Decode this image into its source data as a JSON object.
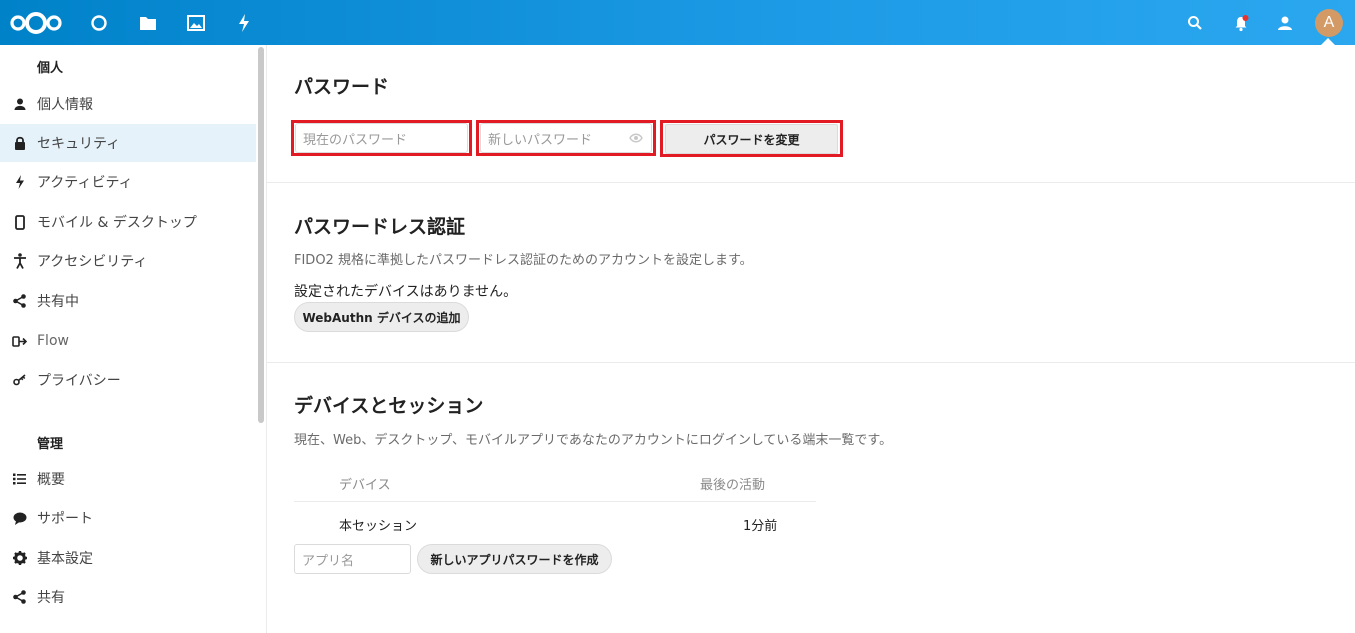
{
  "header": {
    "avatar_letter": "A",
    "accent": "#0082c9"
  },
  "sidebar": {
    "personal_caption": "個人",
    "personal_items": [
      {
        "label": "個人情報",
        "icon": "user-icon"
      },
      {
        "label": "セキュリティ",
        "icon": "lock-icon"
      },
      {
        "label": "アクティビティ",
        "icon": "activity-icon"
      },
      {
        "label": "モバイル & デスクトップ",
        "icon": "phone-icon"
      },
      {
        "label": "アクセシビリティ",
        "icon": "accessibility-icon"
      },
      {
        "label": "共有中",
        "icon": "share-icon"
      },
      {
        "label": "Flow",
        "icon": "flow-icon"
      },
      {
        "label": "プライバシー",
        "icon": "key-icon"
      }
    ],
    "admin_caption": "管理",
    "admin_items": [
      {
        "label": "概要",
        "icon": "list-icon"
      },
      {
        "label": "サポート",
        "icon": "speech-icon"
      },
      {
        "label": "基本設定",
        "icon": "gear-icon"
      },
      {
        "label": "共有",
        "icon": "share-icon"
      }
    ]
  },
  "password": {
    "title": "パスワード",
    "current_placeholder": "現在のパスワード",
    "new_placeholder": "新しいパスワード",
    "change_label": "パスワードを変更"
  },
  "passwordless": {
    "title": "パスワードレス認証",
    "description": "FIDO2 規格に準拠したパスワードレス認証のためのアカウントを設定します。",
    "no_devices": "設定されたデバイスはありません。",
    "add_button": "WebAuthn デバイスの追加"
  },
  "sessions": {
    "title": "デバイスとセッション",
    "description": "現在、Web、デスクトップ、モバイルアプリであなたのアカウントにログインしている端末一覧です。",
    "col_device": "デバイス",
    "col_last_activity": "最後の活動",
    "rows": [
      {
        "device": "本セッション",
        "last_activity": "1分前"
      }
    ],
    "app_name_placeholder": "アプリ名",
    "create_button": "新しいアプリパスワードを作成"
  }
}
